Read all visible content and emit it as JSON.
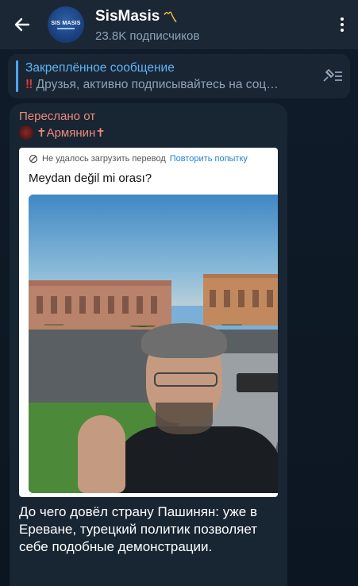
{
  "header": {
    "back_icon": "arrow-left-icon",
    "avatar_text": "SIS MASIS",
    "title": "SisMasis",
    "title_mark": "〽",
    "subscribers": "23.8K подписчиков",
    "menu_icon": "more-vertical-icon"
  },
  "pinned": {
    "title": "Закреплённое сообщение",
    "bang": "‼",
    "message": " Друзья, активно подписывайтесь на соц…",
    "list_icon": "pin-list-icon"
  },
  "message": {
    "forwarded_label": "Переслано от",
    "forwarded_author": "✝Армянин✝",
    "embed": {
      "translate_fail": "Не удалось загрузить перевод",
      "translate_retry": "Повторить попытку",
      "text": "Meydan değil mi orası?"
    },
    "caption": "До чего довёл страну Пашинян: уже в Ереване, турецкий политик позволяет себе подобные демонстрации."
  },
  "colors": {
    "header_bg": "#1b2735",
    "accent_blue": "#5eb5f7",
    "forward_color": "#f08a7a",
    "bubble_bg": "#182533"
  }
}
